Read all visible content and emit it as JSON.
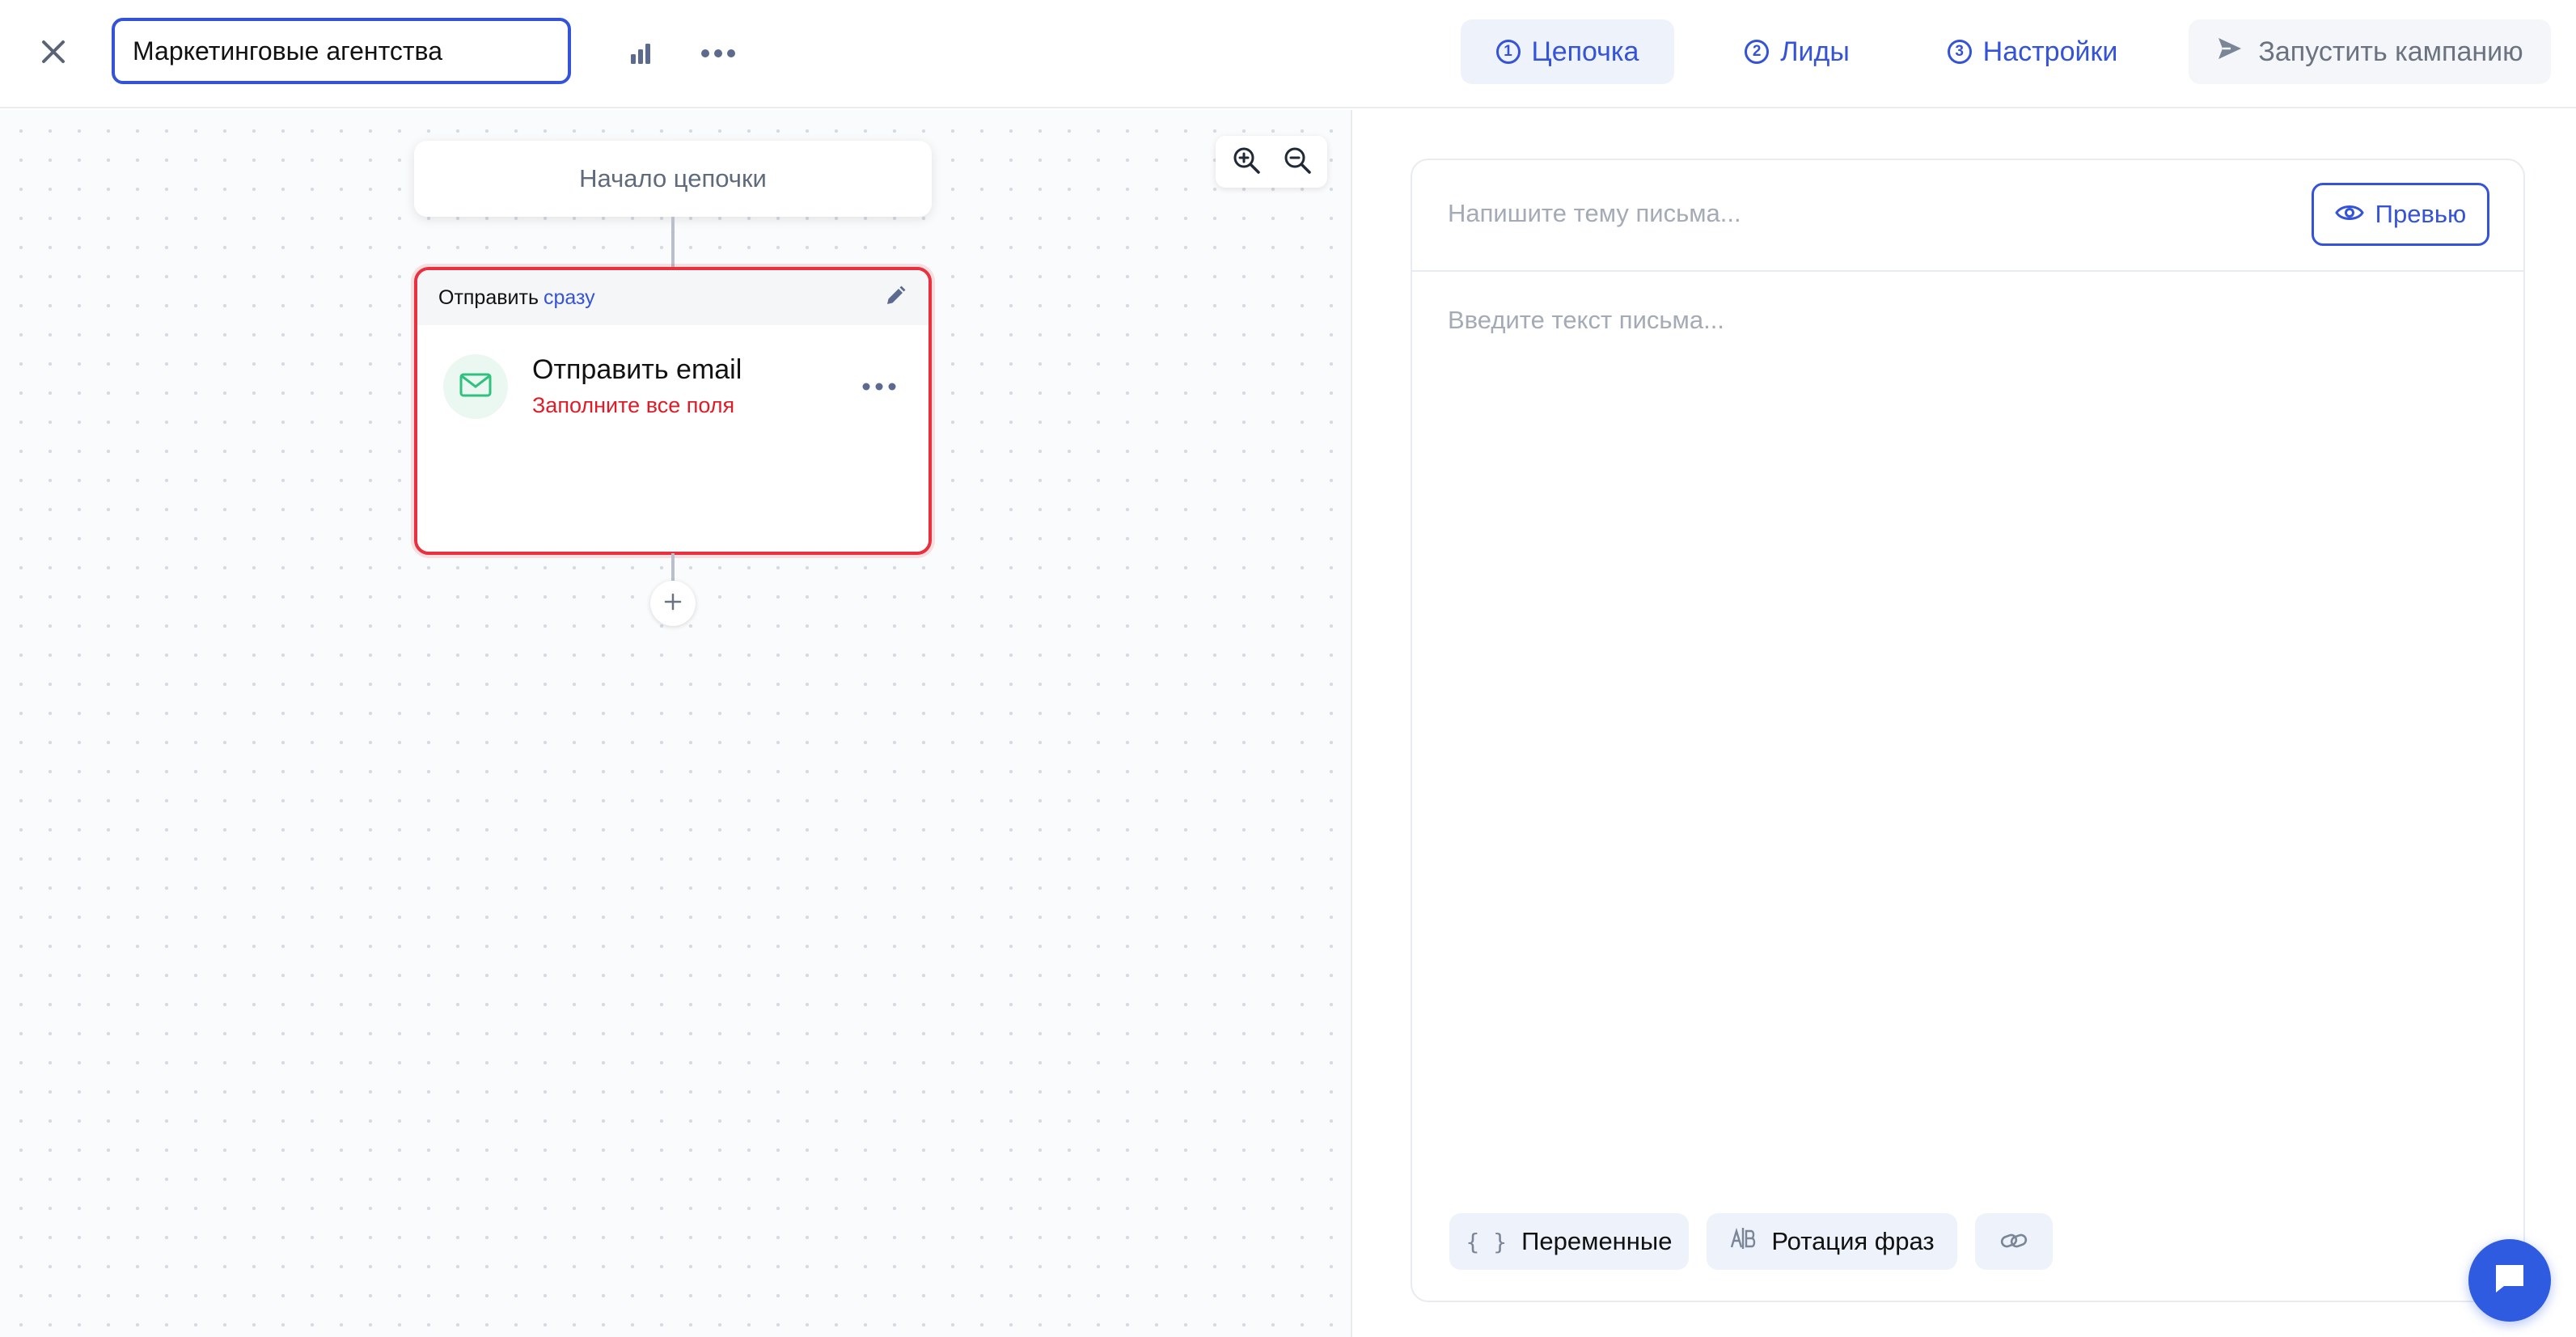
{
  "header": {
    "campaign_name": "Маркетинговые агентства",
    "tabs": [
      {
        "number": "1",
        "label": "Цепочка",
        "active": true
      },
      {
        "number": "2",
        "label": "Лиды",
        "active": false
      },
      {
        "number": "3",
        "label": "Настройки",
        "active": false
      }
    ],
    "launch_label": "Запустить кампанию"
  },
  "chain": {
    "start_label": "Начало цепочки",
    "step": {
      "action_prefix": "Отправить",
      "timing": "сразу",
      "title": "Отправить email",
      "error": "Заполните все поля"
    }
  },
  "editor": {
    "subject_placeholder": "Напишите тему письма...",
    "body_placeholder": "Введите текст письма...",
    "preview_label": "Превью",
    "variables_label": "Переменные",
    "variables_icon_text": "{ }",
    "rotation_label": "Ротация фраз"
  },
  "icons": {
    "close": "close-icon",
    "stats": "bar-chart-icon",
    "more": "more-dots-icon",
    "zoom_in": "zoom-in-icon",
    "zoom_out": "zoom-out-icon",
    "edit": "pencil-icon",
    "mail": "mail-icon",
    "add": "plus-icon",
    "preview": "eye-icon",
    "rotation": "rotation-icon",
    "link": "link-icon",
    "send": "send-icon",
    "chat": "chat-icon"
  },
  "colors": {
    "accent": "#3553d8",
    "error": "#e01c27",
    "success": "#2ec27e",
    "chat": "#2f5be0"
  }
}
